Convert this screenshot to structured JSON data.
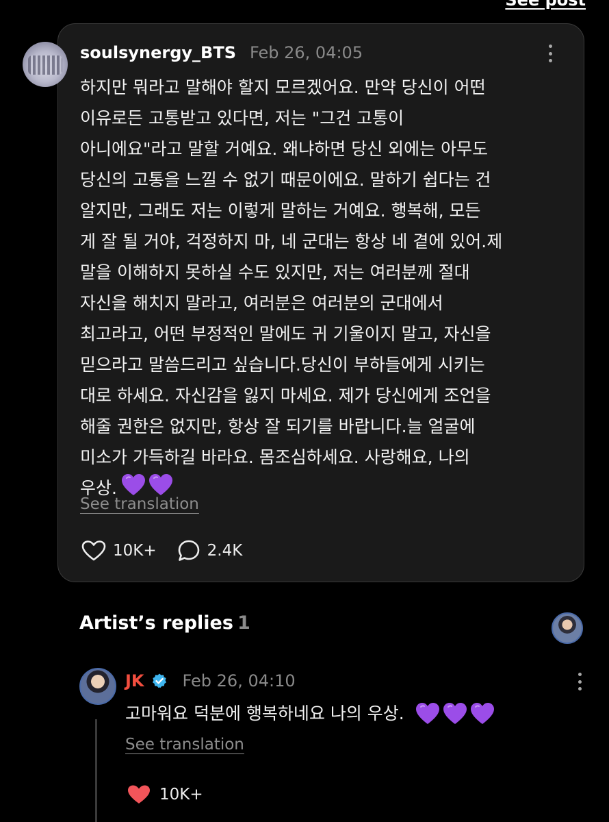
{
  "header": {
    "see_post_label": "See post"
  },
  "post": {
    "username": "soulsynergy_BTS",
    "timestamp": "Feb 26, 04:05",
    "body_lines": [
      "하지만 뭐라고 말해야 할지 모르겠어요. 만약 당신이 어떤",
      "이유로든 고통받고 있다면, 저는 \"그건 고통이",
      "아니에요\"라고 말할 거예요. 왜냐하면 당신 외에는 아무도",
      "당신의 고통을 느낄 수 없기 때문이에요. 말하기 쉽다는 건",
      "알지만, 그래도 저는 이렇게 말하는 거예요. 행복해, 모든",
      "게 잘 될 거야, 걱정하지 마, 네 군대는 항상 네 곁에 있어.제",
      "말을 이해하지 못하실 수도 있지만, 저는 여러분께 절대",
      "자신을 해치지 말라고, 여러분은 여러분의 군대에서",
      "최고라고, 어떤 부정적인 말에도 귀 기울이지 말고, 자신을",
      "믿으라고 말씀드리고 싶습니다.당신이 부하들에게 시키는",
      "대로 하세요. 자신감을 잃지 마세요. 제가 당신에게 조언을",
      "해줄 권한은 없지만, 항상 잘 되기를 바랍니다.늘 얼굴에",
      "미소가 가득하길 바라요. 몸조심하세요. 사랑해요, 나의",
      "우상."
    ],
    "see_translation": "See translation",
    "like_count": "10K+",
    "comment_count": "2.4K",
    "emoji_icons": [
      "purple-heart-icon",
      "purple-heart-icon"
    ]
  },
  "replies_section": {
    "title": "Artist’s replies",
    "count": "1"
  },
  "reply": {
    "name": "JK",
    "timestamp": "Feb 26, 04:10",
    "text": "고마워요 덕분에 행복하네요 나의 우상.",
    "see_translation": "See translation",
    "like_count": "10K+",
    "emoji_icons": [
      "purple-heart-icon",
      "purple-heart-icon",
      "purple-heart-icon"
    ]
  },
  "colors": {
    "background": "#000000",
    "card": "#1a1a1a",
    "artist_name": "#f24e3f",
    "verified_badge": "#3fb6f0",
    "liked_heart": "#f2555a",
    "purple_heart": "#9b4de8"
  }
}
